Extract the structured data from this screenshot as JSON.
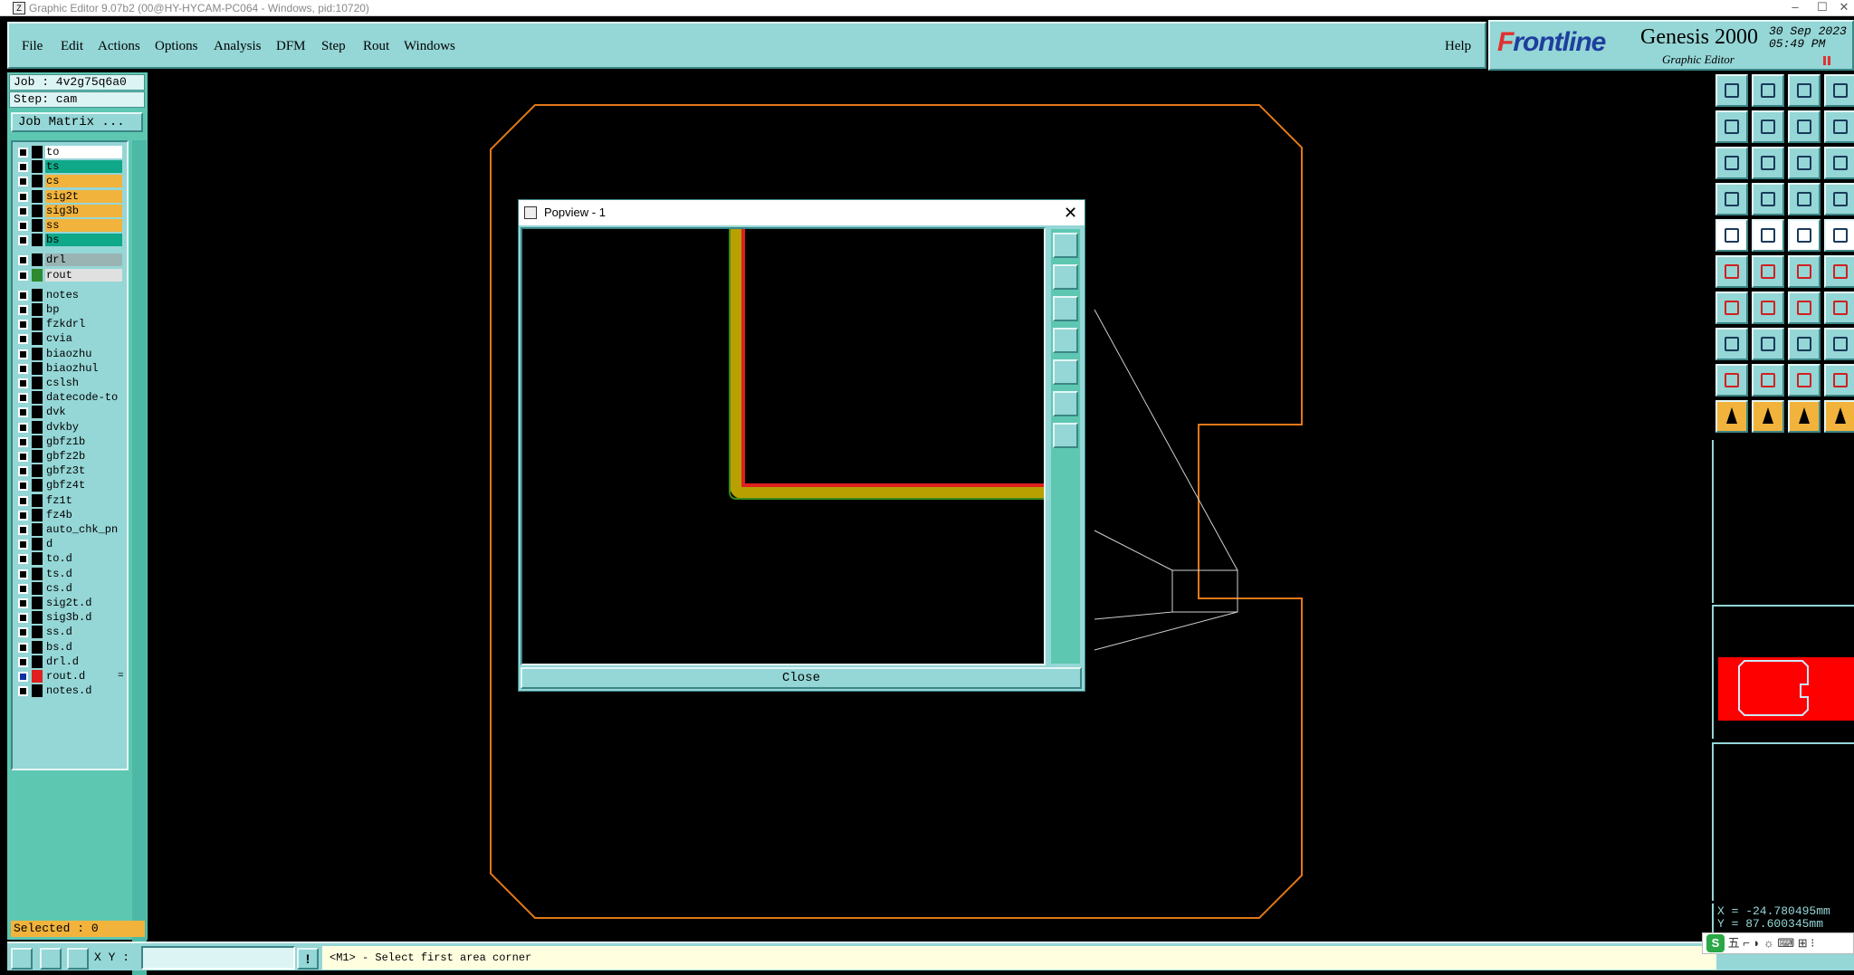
{
  "window": {
    "title": "Graphic Editor 9.07b2 (00@HY-HYCAM-PC064 - Windows, pid:10720)",
    "minimize": "–",
    "maximize": "☐",
    "close": "✕"
  },
  "menu": {
    "items": [
      "File",
      "Edit",
      "Actions",
      "Options",
      "Analysis",
      "DFM",
      "Step",
      "Rout",
      "Windows"
    ],
    "help": "Help"
  },
  "brand": {
    "logo_prefix": "F",
    "logo_rest": "rontline",
    "product": "Genesis 2000",
    "subtitle": "Graphic Editor",
    "date": "30 Sep 2023",
    "time": "05:49 PM"
  },
  "job": {
    "job_label": "Job : 4v2g75q6a0",
    "step_label": "Step: cam",
    "matrix_button": "Job Matrix ..."
  },
  "layers": [
    {
      "name": "to",
      "color": "#ffffff"
    },
    {
      "name": "ts",
      "color": "#0fa888"
    },
    {
      "name": "cs",
      "color": "#f2b33c"
    },
    {
      "name": "sig2t",
      "color": "#f2b33c"
    },
    {
      "name": "sig3b",
      "color": "#f2b33c"
    },
    {
      "name": "ss",
      "color": "#f2b33c"
    },
    {
      "name": "bs",
      "color": "#0fa888"
    },
    {
      "name": "drl",
      "color": "#9ab3b3",
      "gap": true
    },
    {
      "name": "rout",
      "color": "#e0e0e0",
      "swatch": "#2f8a2f"
    },
    {
      "name": "notes",
      "color": "#95d6d6",
      "gap": true
    },
    {
      "name": "bp",
      "color": "#95d6d6"
    },
    {
      "name": "fzkdrl",
      "color": "#95d6d6"
    },
    {
      "name": "cvia",
      "color": "#95d6d6"
    },
    {
      "name": "biaozhu",
      "color": "#95d6d6"
    },
    {
      "name": "biaozhul",
      "color": "#95d6d6"
    },
    {
      "name": "cslsh",
      "color": "#95d6d6"
    },
    {
      "name": "datecode-to",
      "color": "#95d6d6"
    },
    {
      "name": "dvk",
      "color": "#95d6d6"
    },
    {
      "name": "dvkby",
      "color": "#95d6d6"
    },
    {
      "name": "gbfz1b",
      "color": "#95d6d6"
    },
    {
      "name": "gbfz2b",
      "color": "#95d6d6"
    },
    {
      "name": "gbfz3t",
      "color": "#95d6d6"
    },
    {
      "name": "gbfz4t",
      "color": "#95d6d6"
    },
    {
      "name": "fz1t",
      "color": "#95d6d6"
    },
    {
      "name": "fz4b",
      "color": "#95d6d6"
    },
    {
      "name": "auto_chk_pn",
      "color": "#95d6d6"
    },
    {
      "name": "d",
      "color": "#95d6d6"
    },
    {
      "name": "to.d",
      "color": "#95d6d6"
    },
    {
      "name": "ts.d",
      "color": "#95d6d6"
    },
    {
      "name": "cs.d",
      "color": "#95d6d6"
    },
    {
      "name": "sig2t.d",
      "color": "#95d6d6"
    },
    {
      "name": "sig3b.d",
      "color": "#95d6d6"
    },
    {
      "name": "ss.d",
      "color": "#95d6d6"
    },
    {
      "name": "bs.d",
      "color": "#95d6d6"
    },
    {
      "name": "drl.d",
      "color": "#95d6d6"
    },
    {
      "name": "rout.d",
      "color": "#95d6d6",
      "swatch": "#e02020",
      "active": true,
      "marker": "="
    },
    {
      "name": "notes.d",
      "color": "#95d6d6"
    }
  ],
  "selected": "Selected : 0",
  "bottom": {
    "xy_label": "X Y :",
    "xy_value": "",
    "status": "<M1> - Select first area corner",
    "info_icon": "!"
  },
  "coords": {
    "x": "X = -24.780495mm",
    "y": "Y = 87.600345mm"
  },
  "ime": {
    "logo": "S",
    "text": "五 ⌐ ◗ ☼ ⌨ ⊞ ⁝"
  },
  "popview": {
    "title": "Popview - 1",
    "close_x": "✕",
    "close_button": "Close"
  },
  "colors": {
    "panel": "#95d6d6",
    "accent_orange": "#f2b33c",
    "profile": "#e07818",
    "route": "#e02020"
  }
}
